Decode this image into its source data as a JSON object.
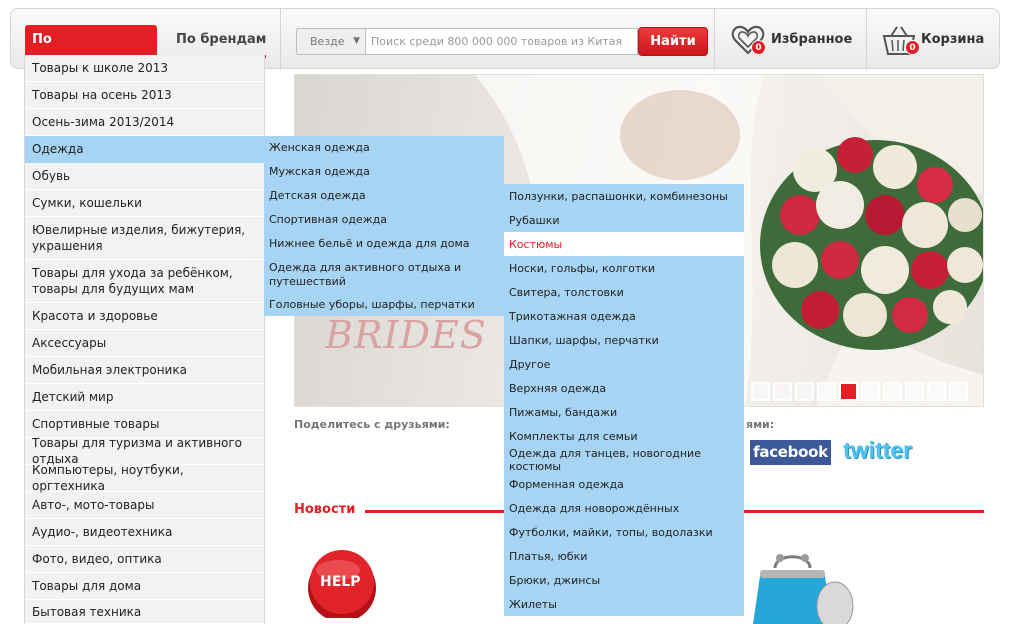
{
  "header": {
    "tab_categories": "По категориям",
    "tab_brands": "По брендам",
    "search_scope": "Везде",
    "search_placeholder": "Поиск среди 800 000 000 товаров из Китая",
    "search_button": "Найти",
    "favorites_label": "Избранное",
    "favorites_count": "0",
    "cart_label": "Корзина",
    "cart_count": "0",
    "accent_color": "#e31e24"
  },
  "menu_categories": [
    "Товары к школе 2013",
    "Товары на осень 2013",
    "Осень-зима 2013/2014",
    "Одежда",
    "Обувь",
    "Сумки, кошельки",
    "Ювелирные изделия, бижутерия, украшения",
    "Товары для ухода за ребёнком, товары для будущих мам",
    "Красота и здоровье",
    "Аксессуары",
    "Мобильная электроника",
    "Детский мир",
    "Спортивные товары",
    "Товары для туризма и активного отдыха",
    "Компьютеры, ноутбуки, оргтехника",
    "Авто-, мото-товары",
    "Аудио-, видеотехника",
    "Фото, видео, оптика",
    "Товары для дома",
    "Бытовая техника"
  ],
  "menu_clothing": [
    "Женская одежда",
    "Мужская одежда",
    "Детская одежда",
    "Спортивная одежда",
    "Нижнее бельё и одежда для дома",
    "Одежда для активного отдыха и путешествий",
    "Головные уборы, шарфы, перчатки"
  ],
  "menu_kids_clothing": [
    "Ползунки, распашонки, комбинезоны",
    "Рубашки",
    "Костюмы",
    "Носки, гольфы, колготки",
    "Свитера, толстовки",
    "Трикотажная одежда",
    "Шапки, шарфы, перчатки",
    "Другое",
    "Верхняя одежда",
    "Пижамы, бандажи",
    "Комплекты для семьи",
    "Одежда для танцев, новогодние костюмы",
    "Форменная одежда",
    "Одежда для новорождённых",
    "Футболки, майки, топы, водолазки",
    "Платья, юбки",
    "Брюки, джинсы",
    "Жилеты"
  ],
  "banner": {
    "caption": "BRIDES",
    "slides": 10,
    "active_slide": 5
  },
  "share": {
    "label": "Поделитесь с друзьями:",
    "label_tail": "ями:",
    "facebook": "facebook",
    "twitter": "twitter"
  },
  "news": {
    "title": "Новости",
    "help_button_text": "HELP"
  }
}
